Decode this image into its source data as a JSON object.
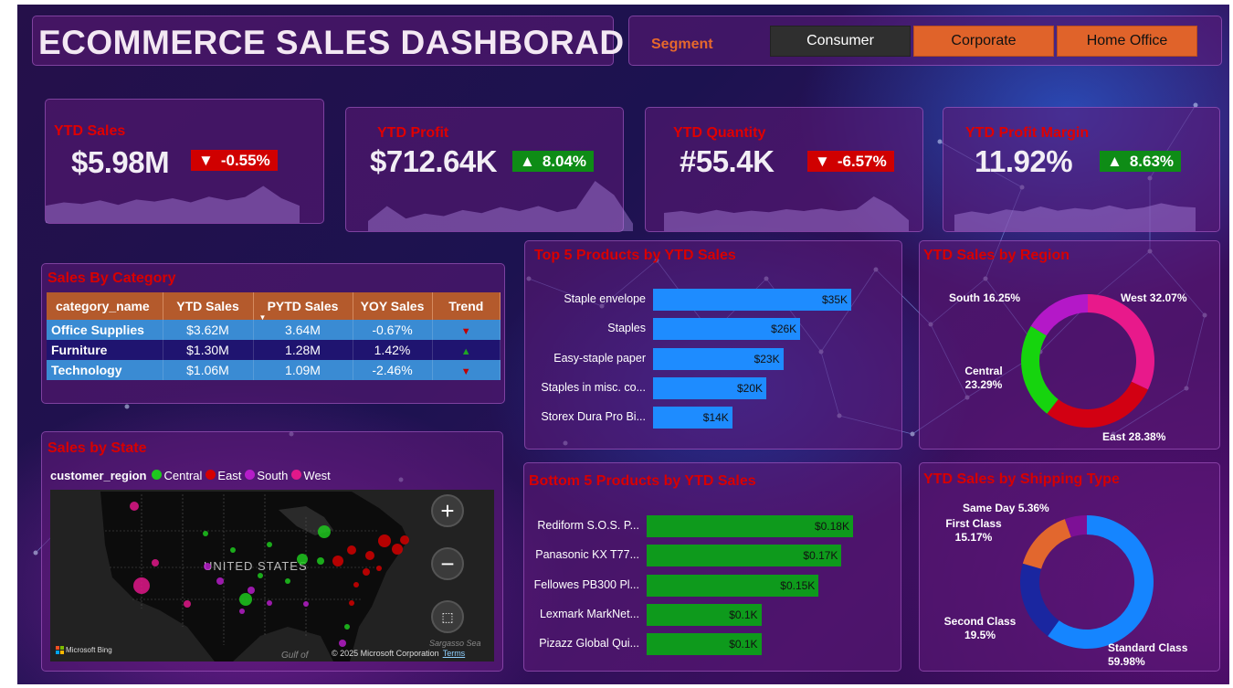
{
  "header": {
    "title": "ECOMMERCE SALES  DASHBORAD"
  },
  "segment": {
    "label": "Segment",
    "options": [
      "Consumer",
      "Corporate",
      "Home Office"
    ],
    "selected": "Consumer"
  },
  "kpis": [
    {
      "title": "YTD Sales",
      "value": "$5.98M",
      "delta": "-0.55%",
      "direction": "down",
      "spark": [
        0.42,
        0.5,
        0.46,
        0.55,
        0.44,
        0.57,
        0.52,
        0.6,
        0.5,
        0.64,
        0.55,
        0.63,
        0.9,
        0.6,
        0.42
      ]
    },
    {
      "title": "YTD Profit",
      "value": "$712.64K",
      "delta": "8.04%",
      "direction": "up",
      "spark": [
        0.2,
        0.5,
        0.25,
        0.35,
        0.3,
        0.42,
        0.36,
        0.48,
        0.4,
        0.5,
        0.38,
        0.45,
        1.0,
        0.72,
        0.15
      ]
    },
    {
      "title": "YTD Quantity",
      "value": "#55.4K",
      "delta": "-6.57%",
      "direction": "down",
      "spark": [
        0.5,
        0.55,
        0.48,
        0.58,
        0.5,
        0.56,
        0.52,
        0.6,
        0.55,
        0.62,
        0.55,
        0.6,
        0.95,
        0.7,
        0.3
      ]
    },
    {
      "title": "YTD Profit Margin",
      "value": "11.92%",
      "delta": "8.63%",
      "direction": "up",
      "spark": [
        0.5,
        0.6,
        0.52,
        0.66,
        0.6,
        0.75,
        0.62,
        0.7,
        0.65,
        0.78,
        0.66,
        0.72,
        0.85,
        0.75,
        0.72
      ]
    }
  ],
  "category_table": {
    "title": "Sales By Category",
    "columns": [
      "category_name",
      "YTD Sales",
      "PYTD Sales",
      "YOY Sales",
      "Trend"
    ],
    "rows": [
      {
        "name": "Office Supplies",
        "ytd": "$3.62M",
        "pytd": "3.64M",
        "yoy": "-0.67%",
        "trend": "down"
      },
      {
        "name": "Furniture",
        "ytd": "$1.30M",
        "pytd": "1.28M",
        "yoy": "1.42%",
        "trend": "up"
      },
      {
        "name": "Technology",
        "ytd": "$1.06M",
        "pytd": "1.09M",
        "yoy": "-2.46%",
        "trend": "down"
      }
    ]
  },
  "map": {
    "title": "Sales by State",
    "legend_title": "customer_region",
    "legend": [
      {
        "name": "Central",
        "color": "#1ec81e"
      },
      {
        "name": "East",
        "color": "#d40000"
      },
      {
        "name": "South",
        "color": "#b51dc8"
      },
      {
        "name": "West",
        "color": "#e0188a"
      }
    ],
    "country_label": "UNITED STATES",
    "gulf_label": "Gulf of",
    "sea_label": "Sargasso Sea",
    "attribution": "Microsoft Bing",
    "copyright": "© 2025 Microsoft Corporation",
    "terms": "Terms",
    "zoom_in": "+",
    "zoom_out": "−"
  },
  "chart_data": [
    {
      "type": "bar",
      "title": "Top 5 Products by YTD Sales",
      "categories": [
        "Staple envelope",
        "Staples",
        "Easy-staple paper",
        "Staples in misc. co...",
        "Storex Dura Pro Bi..."
      ],
      "values": [
        35,
        26,
        23,
        20,
        14
      ],
      "labels": [
        "$35K",
        "$26K",
        "$23K",
        "$20K",
        "$14K"
      ],
      "orientation": "horizontal",
      "color": "#1e8cff"
    },
    {
      "type": "bar",
      "title": "Bottom 5 Products by YTD Sales",
      "categories": [
        "Rediform S.O.S. P...",
        "Panasonic KX T77...",
        "Fellowes PB300 Pl...",
        "Lexmark MarkNet...",
        "Pizazz Global Qui..."
      ],
      "values": [
        0.18,
        0.17,
        0.15,
        0.1,
        0.1
      ],
      "labels": [
        "$0.18K",
        "$0.17K",
        "$0.15K",
        "$0.1K",
        "$0.1K"
      ],
      "orientation": "horizontal",
      "color": "#0e9a1c"
    },
    {
      "type": "pie",
      "title": "YTD Sales by Region",
      "series": [
        {
          "name": "West",
          "value": 32.07,
          "color": "#e8198b",
          "label": "West 32.07%"
        },
        {
          "name": "East",
          "value": 28.38,
          "color": "#d20012",
          "label": "East 28.38%"
        },
        {
          "name": "Central",
          "value": 23.29,
          "color": "#16d40e",
          "label": "Central\n23.29%"
        },
        {
          "name": "South",
          "value": 16.25,
          "color": "#b418c8",
          "label": "South 16.25%"
        }
      ]
    },
    {
      "type": "pie",
      "title": "YTD Sales by Shipping Type",
      "series": [
        {
          "name": "Standard Class",
          "value": 59.98,
          "color": "#1585ff",
          "label": "Standard Class\n59.98%"
        },
        {
          "name": "Second Class",
          "value": 19.5,
          "color": "#1a26a0",
          "label": "Second Class\n19.5%"
        },
        {
          "name": "First Class",
          "value": 15.17,
          "color": "#e2672e",
          "label": "First Class\n15.17%"
        },
        {
          "name": "Same Day",
          "value": 5.36,
          "color": "#7d1096",
          "label": "Same Day 5.36%"
        }
      ]
    }
  ]
}
